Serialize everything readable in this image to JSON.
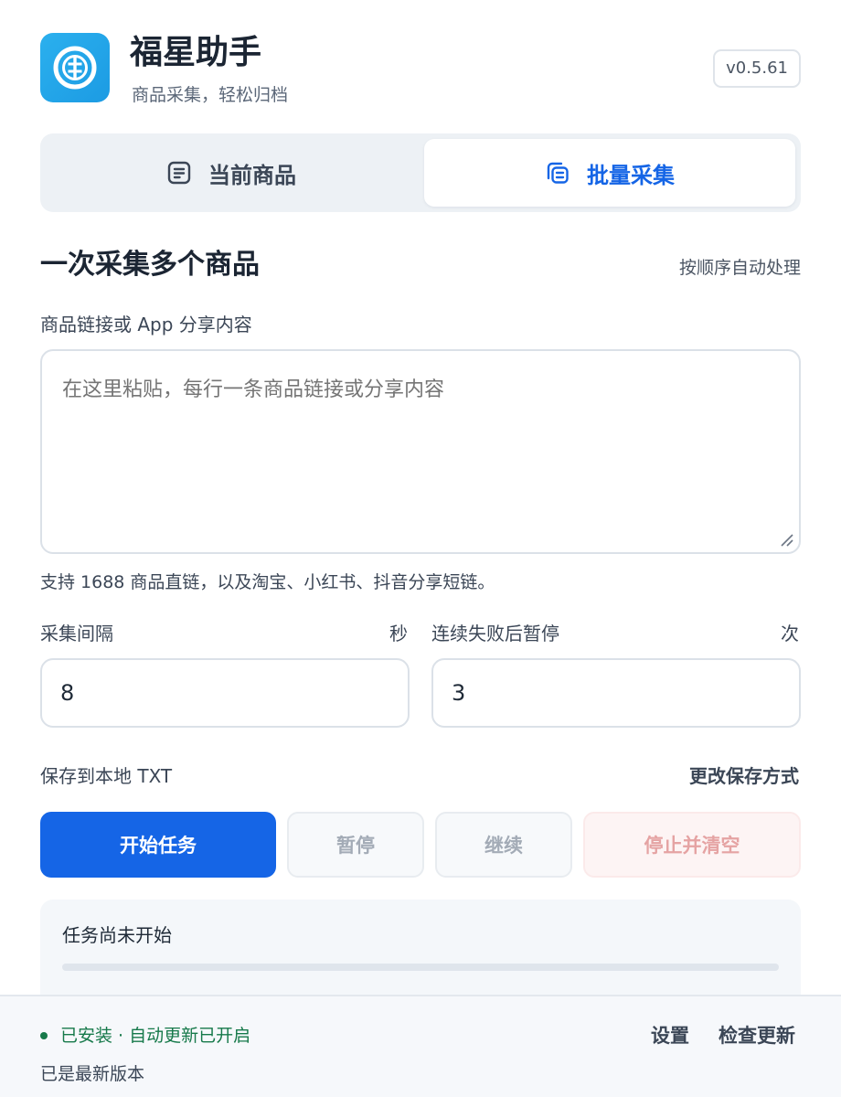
{
  "app": {
    "title": "福星助手",
    "subtitle": "商品采集，轻松归档",
    "version": "v0.5.61",
    "logo_icon": "coin-logo-icon",
    "brand_color": "#1c9be3"
  },
  "tabs": [
    {
      "label": "当前商品",
      "icon": "document-icon",
      "active": false
    },
    {
      "label": "批量采集",
      "icon": "stack-icon",
      "active": true
    }
  ],
  "section": {
    "title": "一次采集多个商品",
    "hint": "按顺序自动处理"
  },
  "links_field": {
    "label": "商品链接或 App 分享内容",
    "placeholder": "在这里粘贴，每行一条商品链接或分享内容",
    "value": "",
    "note": "支持 1688 商品直链，以及淘宝、小红书、抖音分享短链。"
  },
  "interval": {
    "label": "采集间隔",
    "unit": "秒",
    "value": "8"
  },
  "fail_pause": {
    "label": "连续失败后暂停",
    "unit": "次",
    "value": "3"
  },
  "save": {
    "label": "保存到本地 TXT",
    "change_link": "更改保存方式"
  },
  "buttons": {
    "start": "开始任务",
    "pause": "暂停",
    "resume": "继续",
    "stop": "停止并清空"
  },
  "status": {
    "text": "任务尚未开始",
    "progress": 0
  },
  "footer": {
    "install_status": "已安装 · 自动更新已开启",
    "latest": "已是最新版本",
    "settings": "设置",
    "check_update": "检查更新",
    "status_color": "#16794a"
  },
  "colors": {
    "primary": "#1565e6",
    "danger_soft": "#e5a3a3"
  }
}
